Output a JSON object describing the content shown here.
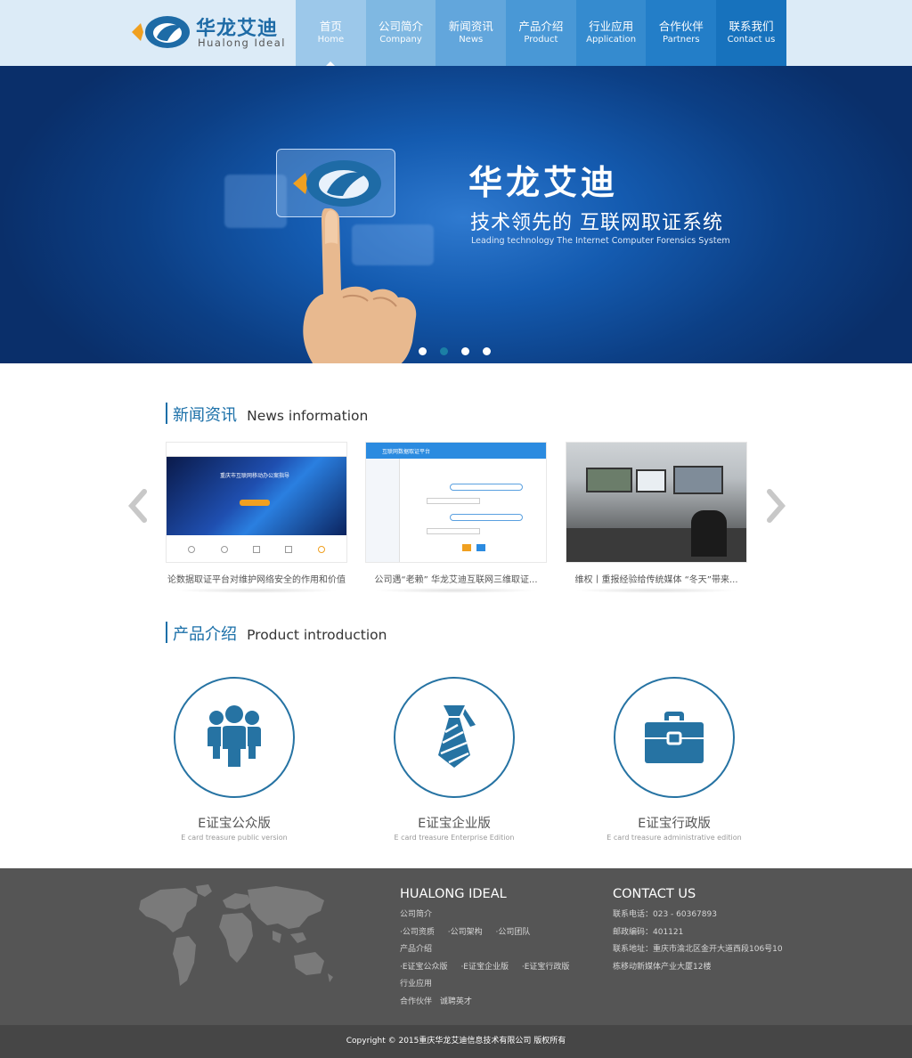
{
  "brand": {
    "name_cn": "华龙艾迪",
    "name_en": "Hualong Ideal",
    "colors": {
      "primary": "#1e6ba6",
      "accent_orange": "#f0a020",
      "nav_bg": "#1a7fc4",
      "footer_bg": "#555555"
    }
  },
  "nav": {
    "items": [
      {
        "cn": "首页",
        "en": "Home",
        "active": true,
        "bg": "#9cc8ea"
      },
      {
        "cn": "公司简介",
        "en": "Company",
        "bg": "#7fb8e2"
      },
      {
        "cn": "新闻资讯",
        "en": "News",
        "bg": "#62a6dc"
      },
      {
        "cn": "产品介绍",
        "en": "Product",
        "bg": "#4998d6"
      },
      {
        "cn": "行业应用",
        "en": "Application",
        "bg": "#358bcf"
      },
      {
        "cn": "合作伙伴",
        "en": "Partners",
        "bg": "#237ec8"
      },
      {
        "cn": "联系我们",
        "en": "Contact us",
        "bg": "#1772bd"
      }
    ]
  },
  "banner": {
    "title": "华龙艾迪",
    "subtitle": "技术领先的  互联网取证系统",
    "subtitle_en": "Leading technology  The Internet Computer Forensics System",
    "slide_count": 4,
    "active_slide": 2
  },
  "news": {
    "heading_cn": "新闻资讯",
    "heading_en": "News information",
    "items": [
      {
        "title": "论数据取证平台对维护网络安全的作用和价值",
        "thumb_caption": "重庆市互联网移动办公案指导"
      },
      {
        "title": "公司遇“老赖” 华龙艾迪互联网三维取证...",
        "thumb_caption": "互联网数据取证平台"
      },
      {
        "title": "维权丨重报经验给传统媒体 “冬天”带来..."
      }
    ],
    "prev_icon": "chevron-left-icon",
    "next_icon": "chevron-right-icon"
  },
  "products": {
    "heading_cn": "产品介绍",
    "heading_en": "Product introduction",
    "items": [
      {
        "name": "E证宝公众版",
        "sub": "E card treasure public version",
        "icon": "people-icon"
      },
      {
        "name": "E证宝企业版",
        "sub": "E card treasure Enterprise Edition",
        "icon": "tie-icon"
      },
      {
        "name": "E证宝行政版",
        "sub": "E card treasure administrative edition",
        "icon": "briefcase-icon"
      }
    ]
  },
  "footer": {
    "col1": {
      "title": "HUALONG IDEAL",
      "company": "公司简介",
      "company_links": [
        "·公司资质",
        "·公司架构",
        "·公司团队"
      ],
      "product": "产品介绍",
      "product_links": [
        "·E证宝公众版",
        "·E证宝企业版",
        "·E证宝行政版"
      ],
      "industry": "行业应用",
      "partners": "合作伙伴",
      "recruit": "诚聘英才"
    },
    "col2": {
      "title": "CONTACT US",
      "phone": "联系电话：023 - 60367893",
      "postcode": "邮政编码：401121",
      "address_1": "联系地址：重庆市渝北区金开大道西段106号10",
      "address_2": "栋移动新媒体产业大厦12楼"
    },
    "copyright": "Copyright © 2015重庆华龙艾迪信息技术有限公司 版权所有"
  }
}
